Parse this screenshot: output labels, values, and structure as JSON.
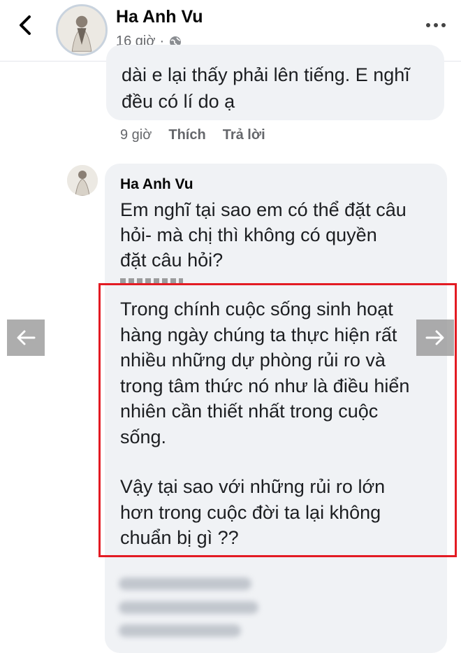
{
  "header": {
    "poster_name": "Ha Anh Vu",
    "time": "16 giờ",
    "separator": "·"
  },
  "previous_comment": {
    "visible_lines": [
      "dài e lại thấy phải lên tiếng. E nghĩ",
      "đều có lí do ạ"
    ],
    "time": "9 giờ",
    "like_label": "Thích",
    "reply_label": "Trả lời"
  },
  "reply": {
    "author": "Ha Anh Vu",
    "lines": [
      "Em nghĩ tại sao em có thể đặt câu",
      "hỏi- mà chị thì không có quyền",
      "đặt câu hỏi?"
    ],
    "highlighted_paragraph_1": [
      "Trong chính cuộc sống sinh hoạt",
      "hàng ngày chúng ta thực hiện rất",
      "nhiều những dự phòng rủi ro và",
      "trong tâm thức nó như là điều hiển",
      "nhiên cần thiết nhất trong cuộc",
      "sống."
    ],
    "highlighted_paragraph_2": [
      "Vậy tại sao với những rủi ro lớn",
      "hơn trong cuộc đời ta lại không",
      "chuẩn bị gì ??"
    ]
  },
  "colors": {
    "highlight_border": "#e31b23",
    "bubble_bg": "#f0f2f5",
    "secondary_text": "#65676b"
  },
  "icons": {
    "back": "chevron-left-icon",
    "privacy": "globe-icon",
    "more": "more-horizontal-icon",
    "prev": "arrow-left-icon",
    "next": "arrow-right-icon"
  }
}
